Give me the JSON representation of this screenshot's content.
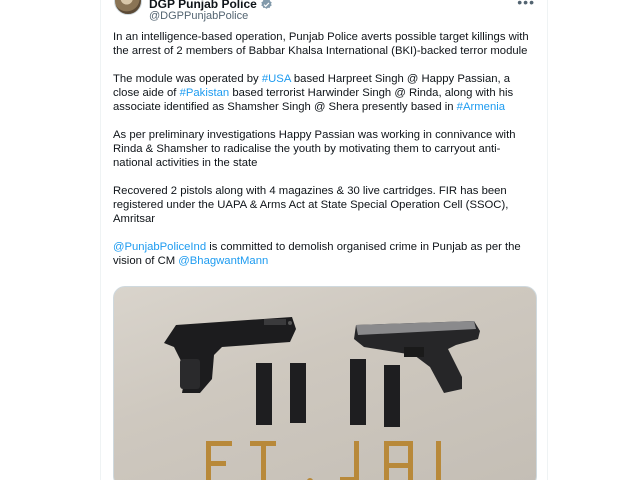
{
  "tweet": {
    "author_name": "DGP Punjab Police",
    "author_handle": "@DGPPunjabPolice",
    "more_icon": "more-horizontal-icon",
    "verified_icon": "verified-badge-icon",
    "verified_color": "#829aab",
    "link_color": "#1d9bf0",
    "paragraph1": "In an intelligence-based operation, Punjab Police averts possible target killings with the arrest of 2 members of Babbar Khalsa International (BKI)-backed terror module",
    "p2_a": "The module was operated by ",
    "p2_hashtag1": "#USA",
    "p2_b": " based Harpreet Singh @ Happy Passian, a close aide of ",
    "p2_hashtag2": "#Pakistan",
    "p2_c": " based terrorist Harwinder Singh @ Rinda, along with his associate identified as Shamsher Singh @ Shera presently based in ",
    "p2_hashtag3": "#Armenia",
    "paragraph3": "As per preliminary investigations Happy Passian was working in connivance with Rinda & Shamsher to radicalise the youth by motivating them to carryout anti-national activities in the state",
    "paragraph4": "Recovered 2 pistols along with 4 magazines & 30 live cartridges. FIR has been registered under the UAPA & Arms Act at State Special Operation Cell (SSOC), Amritsar",
    "p5_mention1": "@PunjabPoliceInd",
    "p5_a": " is committed to demolish organised crime in Punjab as per the vision of CM ",
    "p5_mention2": "@BhagwantMann",
    "media_description": "photo-recovered-weapons"
  }
}
